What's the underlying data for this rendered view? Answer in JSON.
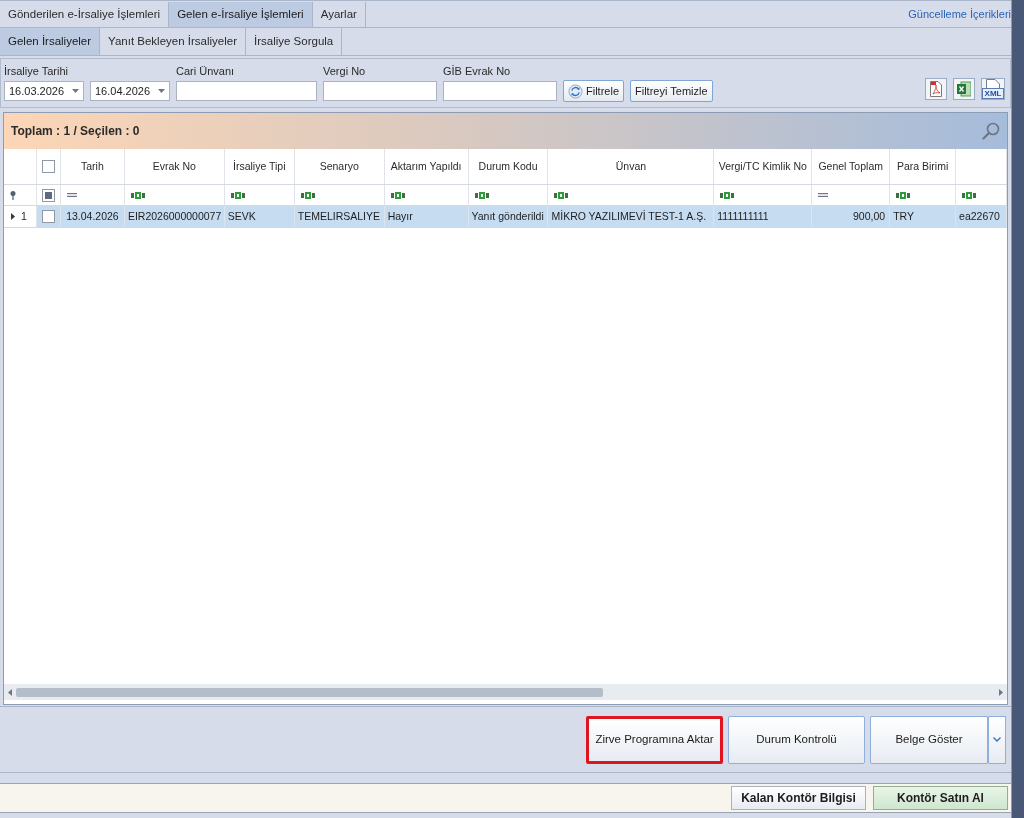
{
  "top_tabs": {
    "items": [
      {
        "label": "Gönderilen e-İrsaliye İşlemleri",
        "selected": false
      },
      {
        "label": "Gelen e-İrsaliye İşlemleri",
        "selected": true
      },
      {
        "label": "Ayarlar",
        "selected": false
      }
    ],
    "link": "Güncelleme İçerikleri"
  },
  "sub_tabs": [
    {
      "label": "Gelen İrsaliyeler",
      "selected": true
    },
    {
      "label": "Yanıt Bekleyen İrsaliyeler",
      "selected": false
    },
    {
      "label": "İrsaliye Sorgula",
      "selected": false
    }
  ],
  "filters": {
    "date_label": "İrsaliye Tarihi",
    "dates": [
      "16.03.2026",
      "16.04.2026"
    ],
    "fields": [
      {
        "label": "Cari Ünvanı"
      },
      {
        "label": "Vergi No"
      },
      {
        "label": "GİB Evrak No"
      }
    ],
    "buttons": [
      {
        "label": "Filtrele",
        "kind": "refresh"
      },
      {
        "label": "Filtreyi Temizle",
        "kind": "plain"
      }
    ],
    "exports": [
      {
        "kind": "pdf"
      },
      {
        "kind": "spreadsheet"
      },
      {
        "kind": "xml",
        "label": "XML"
      }
    ]
  },
  "grid": {
    "summary": "Toplam : 1 / Seçilen : 0",
    "select_all": {
      "checked": false
    },
    "filter_checkbox": {
      "indeterminate": true
    },
    "columns": [
      {
        "title": "Tarih",
        "kind": "date"
      },
      {
        "title": "Evrak No",
        "kind": "text"
      },
      {
        "title": "İrsaliye Tipi",
        "kind": "text"
      },
      {
        "title": "Senaryo",
        "kind": "text"
      },
      {
        "title": "Aktarım Yapıldı",
        "kind": "text"
      },
      {
        "title": "Durum Kodu",
        "kind": "text"
      },
      {
        "title": "Ünvan",
        "kind": "text"
      },
      {
        "title": "Vergi/TC Kimlik No",
        "kind": "text"
      },
      {
        "title": "Genel Toplam",
        "kind": "amount"
      },
      {
        "title": "Para Birimi",
        "kind": "text"
      },
      {
        "kind": "text"
      }
    ],
    "rows": [
      {
        "number": "1",
        "current": true,
        "selected": true,
        "checked": false,
        "cells": [
          "13.04.2026",
          "EIR2026000000077",
          "SEVK",
          "TEMELIRSALIYE",
          "Hayır",
          "Yanıt gönderildi",
          "MİKRO YAZILIMEVİ TEST-1 A.Ş.",
          "1111111111",
          "900,00",
          "TRY",
          "ea22670"
        ]
      }
    ]
  },
  "actions": [
    {
      "label": "Zirve Programına Aktar",
      "highlighted": true,
      "kind": "plain"
    },
    {
      "label": "Durum Kontrolü",
      "highlighted": false,
      "kind": "plain"
    },
    {
      "label": "Belge Göster",
      "highlighted": false,
      "kind": "split"
    }
  ],
  "status_bar": {
    "buttons": [
      {
        "label": "Kalan Kontör Bilgisi",
        "kind": "plain"
      },
      {
        "label": "Kontör Satın Al",
        "kind": "accent"
      }
    ]
  }
}
